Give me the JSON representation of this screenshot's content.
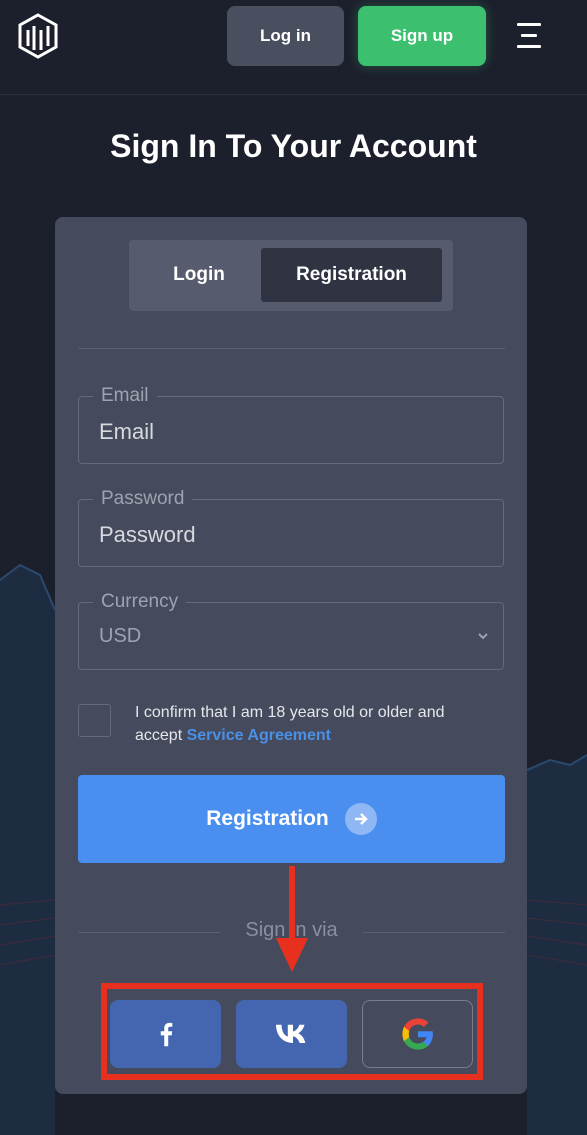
{
  "header": {
    "login_label": "Log in",
    "signup_label": "Sign up"
  },
  "title": "Sign In To Your Account",
  "tabs": {
    "login": "Login",
    "registration": "Registration",
    "active": "registration"
  },
  "form": {
    "email": {
      "legend": "Email",
      "placeholder": "Email",
      "value": ""
    },
    "password": {
      "legend": "Password",
      "placeholder": "Password",
      "value": ""
    },
    "currency": {
      "legend": "Currency",
      "value": "USD"
    },
    "confirm": {
      "text": "I confirm that I am 18 years old or older and accept",
      "link_text": "Service Agreement",
      "checked": false
    },
    "submit_label": "Registration"
  },
  "social": {
    "heading": "Sign in via",
    "providers": [
      "facebook",
      "vk",
      "google"
    ]
  },
  "colors": {
    "background": "#1c1f2c",
    "card": "#454b5c",
    "signup_green": "#3cbf6e",
    "primary_blue": "#4a8ff0",
    "social_blue": "#4466b0",
    "link_blue": "#4a90e8",
    "highlight_red": "#e8301e"
  },
  "icons": {
    "logo": "brand-logo-icon",
    "menu": "hamburger-menu-icon",
    "chevron": "chevron-down-icon",
    "submit_arrow": "arrow-right-icon",
    "facebook": "facebook-icon",
    "vk": "vk-icon",
    "google": "google-icon"
  }
}
